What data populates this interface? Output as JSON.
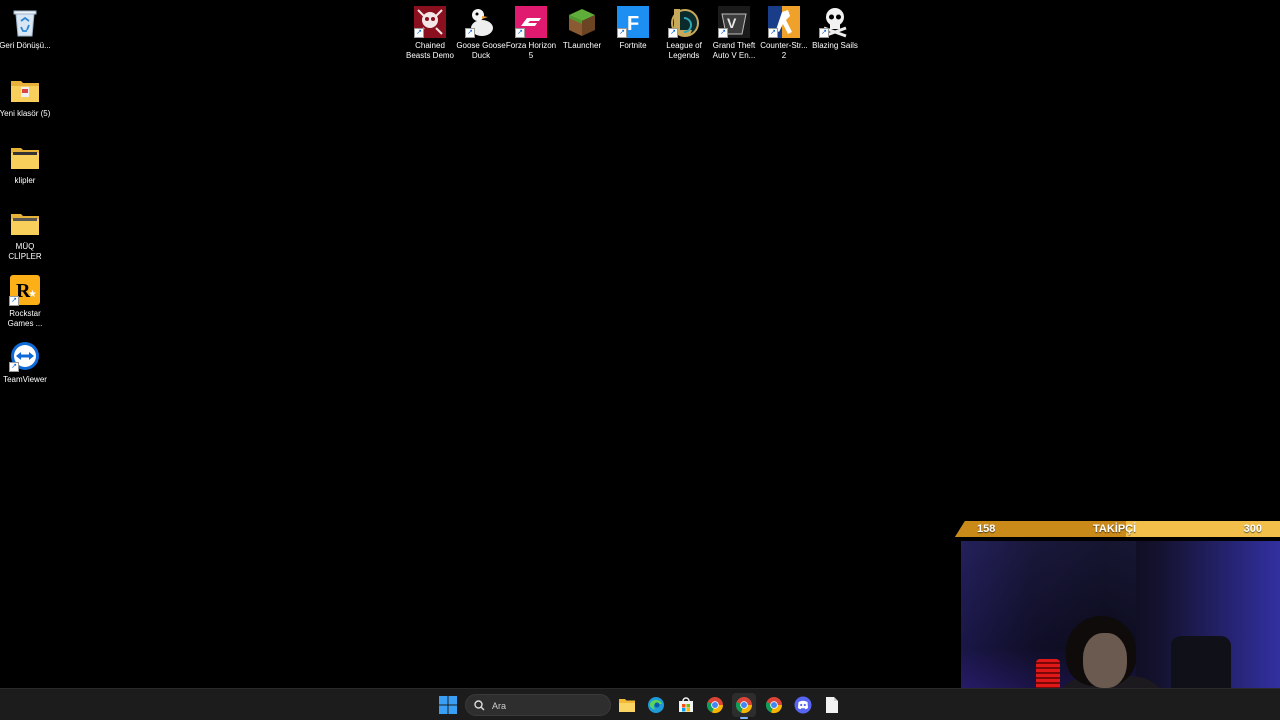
{
  "left_icons": [
    {
      "name": "recycle-bin",
      "label": "Geri Dönüşü..."
    },
    {
      "name": "folder-yeni-klasor",
      "label": "Yeni klasör (5)"
    },
    {
      "name": "folder-klipler",
      "label": "klipler"
    },
    {
      "name": "folder-muq-clipler",
      "label": "MÜQ CLİPLER"
    },
    {
      "name": "rockstar-games",
      "label": "Rockstar Games ..."
    },
    {
      "name": "teamviewer",
      "label": "TeamViewer"
    }
  ],
  "top_icons": [
    {
      "name": "chained-beasts-demo",
      "label": "Chained Beasts Demo"
    },
    {
      "name": "goose-goose-duck",
      "label": "Goose Goose Duck"
    },
    {
      "name": "forza-horizon-5",
      "label": "Forza Horizon 5"
    },
    {
      "name": "tlauncher",
      "label": "TLauncher"
    },
    {
      "name": "fortnite",
      "label": "Fortnite"
    },
    {
      "name": "league-of-legends",
      "label": "League of Legends"
    },
    {
      "name": "grand-theft-auto-v",
      "label": "Grand Theft Auto V En..."
    },
    {
      "name": "counter-strike-2",
      "label": "Counter-Str... 2"
    },
    {
      "name": "blazing-sails",
      "label": "Blazing Sails"
    }
  ],
  "follower_goal": {
    "current": "158",
    "title": "TAKİPÇİ",
    "goal": "300",
    "progress": 0.527,
    "bar_color": "#c98a1a",
    "track_color": "#f2c04a"
  },
  "taskbar": {
    "search_placeholder": "Ara",
    "apps": [
      "start",
      "search",
      "file-explorer",
      "edge",
      "microsoft-store",
      "chrome",
      "chrome-active",
      "chrome-2",
      "discord",
      "notepad"
    ]
  },
  "colors": {
    "desktop_bg": "#000000",
    "taskbar_bg": "#1c1c1c",
    "accent": "#7fb4ff"
  }
}
